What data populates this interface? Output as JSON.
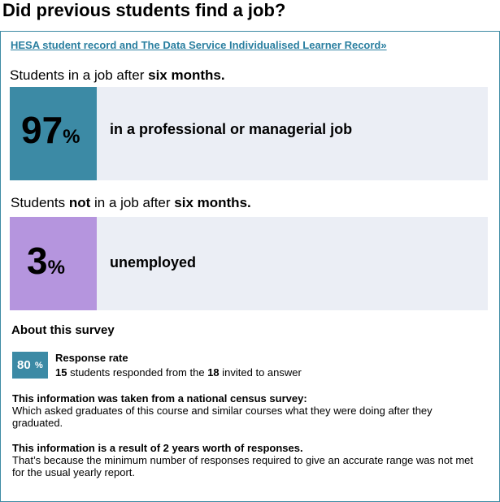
{
  "title": "Did previous students find a job?",
  "source_link": "HESA student record and The Data Service Individualised Learner Record»",
  "employed": {
    "heading_pre": "Students in a job after ",
    "heading_bold": "six months.",
    "value": "97",
    "percent_sign": "%",
    "label": "in a professional or managerial job",
    "box_color": "#3c8aa5"
  },
  "unemployed": {
    "heading_pre": "Students ",
    "heading_not": "not",
    "heading_mid": " in a job after ",
    "heading_bold": "six months.",
    "value": "3",
    "percent_sign": "%",
    "label": "unemployed",
    "box_color": "#b595de"
  },
  "about_heading": "About this survey",
  "response_rate": {
    "value": "80",
    "percent_sign": "%",
    "title": "Response rate",
    "responded": "15",
    "text_mid": " students responded from the ",
    "invited": "18",
    "text_end": " invited to answer"
  },
  "info1": {
    "lead": "This information was taken from a national census survey:",
    "body": "Which asked graduates of this course and similar courses what they were doing after they graduated."
  },
  "info2": {
    "lead": "This information is a result of 2 years worth of responses.",
    "body": "That’s because the minimum number of responses required to give an accurate range was not met for the usual yearly report."
  },
  "colors": {
    "accent": "#3c8aa5",
    "link": "#2a7fa0",
    "row_bg": "#ebeef5",
    "unemployed": "#b595de"
  }
}
